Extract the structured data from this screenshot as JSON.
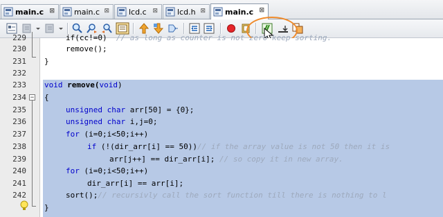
{
  "tabs": [
    {
      "label": "main.c",
      "active": false,
      "bold": true
    },
    {
      "label": "main.c",
      "active": false,
      "bold": false
    },
    {
      "label": "lcd.c",
      "active": false,
      "bold": false
    },
    {
      "label": "lcd.h",
      "active": false,
      "bold": false
    },
    {
      "label": "main.c",
      "active": true,
      "bold": true
    }
  ],
  "tab_close_glyph": "⊠",
  "editor": {
    "line_numbers": [
      "229",
      "230",
      "231",
      "232",
      "233",
      "234",
      "235",
      "236",
      "237",
      "238",
      "239",
      "240",
      "241",
      "242",
      "243"
    ],
    "lines": {
      "l229_code": "if(cc!=0)  ",
      "l229_comment": "// as long as counter is not zero keep sorting.",
      "l230": "remove();",
      "l231": "}",
      "l233_kw": "void",
      "l233_name": " remove(",
      "l233_arg": "void",
      "l233_end": ")",
      "l234": "{",
      "l235_kw": "unsigned char",
      "l235_rest": " arr[50] = {0};",
      "l236_kw": "unsigned char",
      "l236_rest": " i,j=0;",
      "l237_kw": "for",
      "l237_rest": " (i=0;i<50;i++)",
      "l238_kw": "if",
      "l238_rest": " (!(dir_arr[i] == 50))",
      "l238_comment": "// if the array value is not 50 then it is",
      "l239_code": "arr[j++] == dir_arr[i]; ",
      "l239_comment": "// so copy it in new array.",
      "l240_kw": "for",
      "l240_rest": " (i=0;i<50;i++)",
      "l241": "dir_arr[i] == arr[i];",
      "l242_code": "sort();",
      "l242_comment": "// recursivly call the sort function till there is nothing to l",
      "l243": "}"
    }
  },
  "colors": {
    "keyword": "#0000cc",
    "comment": "#9da9bc",
    "selection": "#b7c9e6",
    "highlight_ring": "#ef8a2a"
  },
  "toolbar_icons": [
    "toggle-comment-icon",
    "back-icon",
    "forward-icon",
    "find-icon",
    "find-previous-icon",
    "find-next-icon",
    "toggle-highlight-icon",
    "previous-bookmark-icon",
    "next-bookmark-icon",
    "toggle-bookmark-icon",
    "shift-left-icon",
    "shift-right-icon",
    "record-macro-icon",
    "stop-macro-icon",
    "format-code-icon",
    "indent-icon",
    "diff-icon"
  ]
}
